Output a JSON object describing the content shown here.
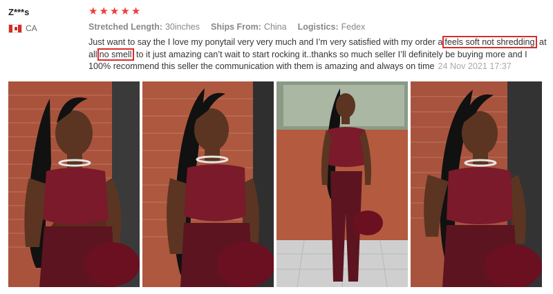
{
  "review": {
    "reviewer_name": "Z***s",
    "country": "CA",
    "rating": 5,
    "attributes": [
      {
        "key": "Stretched Length:",
        "value": "30inches"
      },
      {
        "key": "Ships From:",
        "value": "China"
      },
      {
        "key": "Logistics:",
        "value": "Fedex"
      }
    ],
    "text_1": "Just want to say the I love my ponytail very very much and I’m very satisfied with my order a",
    "highlight_1": "feels soft not shredding",
    "text_2": " at all",
    "highlight_2": "no smell",
    "text_3": "to it just amazing can’t wait to start rocking it..thanks so much seller I’ll definitely be buying more and I 100% recommend this seller the communication with them is amazing and always on time",
    "date": "24 Nov 2021 17:37"
  },
  "colors": {
    "star": "#ef3c3c",
    "highlight_border": "#d92b2b",
    "top": "#7a1a2b",
    "brick": "#b0553c"
  },
  "photos": [
    {
      "icon": "photo-1"
    },
    {
      "icon": "photo-2"
    },
    {
      "icon": "photo-3"
    },
    {
      "icon": "photo-4"
    }
  ]
}
